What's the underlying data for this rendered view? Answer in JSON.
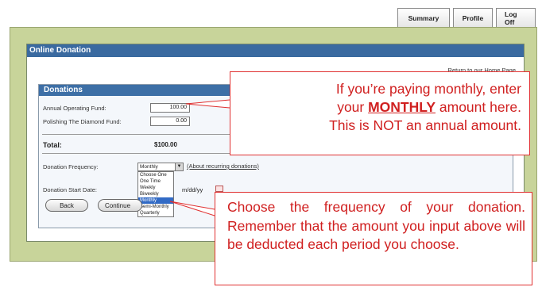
{
  "nav": {
    "tabs": [
      {
        "label": "Summary"
      },
      {
        "label": "Profile"
      },
      {
        "label": "Log Off"
      }
    ]
  },
  "panel": {
    "title": "Online Donation",
    "home_link": "Return to our Home Page"
  },
  "donations": {
    "heading": "Donations",
    "funds": [
      {
        "label": "Annual Operating Fund:",
        "value": "100.00"
      },
      {
        "label": "Polishing The Diamond Fund:",
        "value": "0.00"
      }
    ],
    "total_label": "Total:",
    "total_value": "$100.00",
    "frequency_label": "Donation Frequency:",
    "frequency_selected": "Monthly",
    "about_link": "(About recurring donations)",
    "frequency_options": [
      "Choose One",
      "One Time",
      "Weekly",
      "Biweekly",
      "Monthly",
      "Semi-Monthly",
      "Quarterly"
    ],
    "start_date_label": "Donation Start Date:",
    "date_hint": "m/dd/yy",
    "back_label": "Back",
    "continue_label": "Continue"
  },
  "callouts": {
    "monthly_line1": "If you’re paying monthly, enter",
    "monthly_line2_pre": "your ",
    "monthly_line2_bold": "MONTHLY",
    "monthly_line2_post": " amount here.",
    "monthly_line3": "This is NOT an annual amount.",
    "frequency_text": "Choose the frequency of your donation. Remember that the amount you input above will be deducted each period you choose."
  },
  "colors": {
    "header_blue": "#3a6aa0",
    "frame_green": "#c8d49a",
    "callout_red": "#d02020",
    "highlight_blue": "#316ac5"
  }
}
